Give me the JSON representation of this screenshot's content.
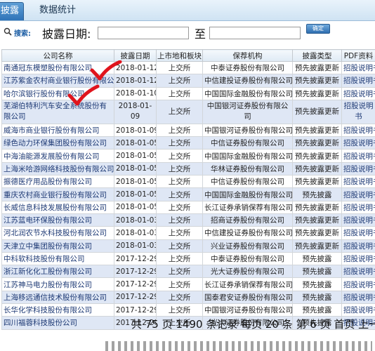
{
  "tabs": {
    "active": "披露",
    "stats": "数据统计"
  },
  "search": {
    "label": "搜索:",
    "field_label": "披露日期:",
    "start_value": "",
    "to_label": "至",
    "end_value": "",
    "confirm_label": "确定"
  },
  "table": {
    "headers": [
      "公司名称",
      "披露日期",
      "上市地和板块",
      "保荐机构",
      "披露类型",
      "PDF资料"
    ],
    "rows": [
      {
        "company": "南通冠东模塑股份有限公司",
        "date": "2018-01-12",
        "market": "上交所",
        "sponsor": "中泰证券股份有限公司",
        "type": "预先披露更新",
        "pdf": "招股说明书"
      },
      {
        "company": "江苏紫金农村商业银行股份有限公司",
        "date": "2018-01-12",
        "market": "上交所",
        "sponsor": "中信建投证券股份有限公司",
        "type": "预先披露更新",
        "pdf": "招股说明书"
      },
      {
        "company": "哈尔滨银行股份有限公司",
        "date": "2018-01-10",
        "market": "上交所",
        "sponsor": "中国国际金融股份有限公司",
        "type": "预先披露更新",
        "pdf": "招股说明书"
      },
      {
        "company": "芜湖伯特利汽车安全系统股份有限公司",
        "date": "2018-01-09",
        "market": "上交所",
        "sponsor": "中国银河证券股份有限公司",
        "type": "预先披露更新",
        "pdf": "招股说明书"
      },
      {
        "company": "威海市商业银行股份有限公司",
        "date": "2018-01-09",
        "market": "上交所",
        "sponsor": "中国银河证券股份有限公司",
        "type": "预先披露更新",
        "pdf": "招股说明书"
      },
      {
        "company": "绿色动力环保集团股份有限公司",
        "date": "2018-01-05",
        "market": "上交所",
        "sponsor": "中信证券股份有限公司",
        "type": "预先披露更新",
        "pdf": "招股说明书"
      },
      {
        "company": "中海油能源发展股份有限公司",
        "date": "2018-01-05",
        "market": "上交所",
        "sponsor": "中国国际金融股份有限公司",
        "type": "预先披露更新",
        "pdf": "招股说明书"
      },
      {
        "company": "上海米哈游网络科技股份有限公司",
        "date": "2018-01-05",
        "market": "上交所",
        "sponsor": "华林证券股份有限公司",
        "type": "预先披露更新",
        "pdf": "招股说明书"
      },
      {
        "company": "振德医疗用品股份有限公司",
        "date": "2018-01-05",
        "market": "上交所",
        "sponsor": "中信证券股份有限公司",
        "type": "预先披露更新",
        "pdf": "招股说明书"
      },
      {
        "company": "重庆农村商业银行股份有限公司",
        "date": "2018-01-05",
        "market": "上交所",
        "sponsor": "中国国际金融股份有限公司",
        "type": "预先披露",
        "pdf": "招股说明书"
      },
      {
        "company": "长威信息科技发展股份有限公司",
        "date": "2018-01-05",
        "market": "上交所",
        "sponsor": "长江证券承销保荐有限公司",
        "type": "预先披露更新",
        "pdf": "招股说明书"
      },
      {
        "company": "江苏蓝电环保股份有限公司",
        "date": "2018-01-03",
        "market": "上交所",
        "sponsor": "招商证券股份有限公司",
        "type": "预先披露更新",
        "pdf": "招股说明书"
      },
      {
        "company": "河北润农节水科技股份有限公司",
        "date": "2018-01-03",
        "market": "上交所",
        "sponsor": "中信建投证券股份有限公司",
        "type": "预先披露更新",
        "pdf": "招股说明书"
      },
      {
        "company": "天津立中集团股份有限公司",
        "date": "2018-01-03",
        "market": "上交所",
        "sponsor": "兴业证券股份有限公司",
        "type": "预先披露更新",
        "pdf": "招股说明书"
      },
      {
        "company": "中科软科技股份有限公司",
        "date": "2017-12-29",
        "market": "上交所",
        "sponsor": "中泰证券股份有限公司",
        "type": "预先披露",
        "pdf": "招股说明书"
      },
      {
        "company": "浙江新化化工股份有限公司",
        "date": "2017-12-29",
        "market": "上交所",
        "sponsor": "光大证券股份有限公司",
        "type": "预先披露",
        "pdf": "招股说明书"
      },
      {
        "company": "江苏神马电力股份有限公司",
        "date": "2017-12-29",
        "market": "上交所",
        "sponsor": "长江证券承销保荐有限公司",
        "type": "预先披露",
        "pdf": "招股说明书"
      },
      {
        "company": "上海移远通信技术股份有限公司",
        "date": "2017-12-29",
        "market": "上交所",
        "sponsor": "国泰君安证券股份有限公司",
        "type": "预先披露",
        "pdf": "招股说明书"
      },
      {
        "company": "长华化学科技股份有限公司",
        "date": "2017-12-29",
        "market": "上交所",
        "sponsor": "中国银河证券股份有限公司",
        "type": "预先披露",
        "pdf": "招股说明书"
      },
      {
        "company": "四川福蓉科技股份公司",
        "date": "2017-12-29",
        "market": "上交所",
        "sponsor": "光大证券股份有限公司",
        "type": "预先披露",
        "pdf": "招股说明书"
      }
    ]
  },
  "pager": {
    "text": "共 75 页 1490 条记录 每页 20 条 第 6 页 首页 上一"
  },
  "colors": {
    "accent": "#2f73b8",
    "row_alt": "#dfe7f5",
    "check_mark": "#e0141c"
  }
}
